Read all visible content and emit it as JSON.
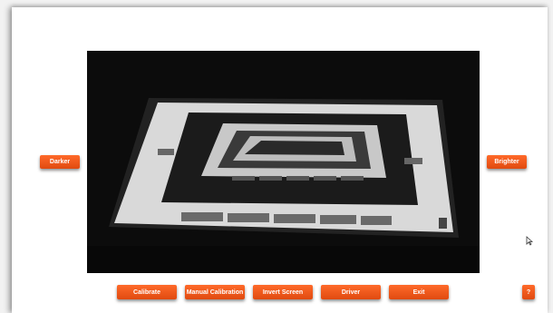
{
  "side_buttons": {
    "darker": "Darker",
    "brighter": "Brighter"
  },
  "toolbar": {
    "calibrate": "Calibrate",
    "manual_calibration": "Manual Calibration",
    "invert_screen": "Invert Screen",
    "driver": "Driver",
    "exit": "Exit",
    "help": "?"
  },
  "icons": {
    "cursor": "mouse-pointer-icon"
  },
  "colors": {
    "accent": "#ef5a1e",
    "camera_background": "#0a0a0a"
  }
}
